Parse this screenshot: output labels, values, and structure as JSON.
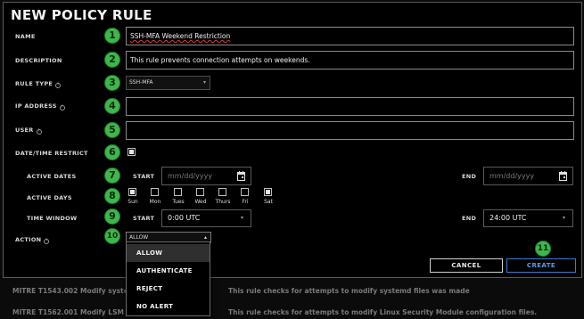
{
  "background_rows": [
    {
      "name": "MITRE T1543.002 Modify systemd",
      "desc": "This rule checks for attempts to modify systemd files was made"
    },
    {
      "name": "MITRE T1562.001 Modify LSM configuration files",
      "desc": "This rule checks for attempts to modify Linux Security Module configuration files."
    }
  ],
  "modal": {
    "title": "NEW POLICY RULE",
    "name": {
      "label": "NAME",
      "value": "SSH-MFA Weekend Restriction"
    },
    "description": {
      "label": "DESCRIPTION",
      "value": "This rule prevents connection attempts on weekends."
    },
    "rule_type": {
      "label": "RULE TYPE",
      "value": "SSH-MFA"
    },
    "ip_address": {
      "label": "IP ADDRESS",
      "value": ""
    },
    "user": {
      "label": "USER",
      "value": ""
    },
    "datetime_restrict": {
      "label": "DATE/TIME RESTRICT",
      "checked": true
    },
    "active_dates": {
      "label": "ACTIVE DATES",
      "start_label": "START",
      "end_label": "END",
      "start_placeholder": "mm/dd/yyyy",
      "end_placeholder": "mm/dd/yyyy"
    },
    "active_days": {
      "label": "ACTIVE DAYS",
      "days": [
        {
          "label": "Sun",
          "checked": true
        },
        {
          "label": "Mon",
          "checked": false
        },
        {
          "label": "Tues",
          "checked": false
        },
        {
          "label": "Wed",
          "checked": false
        },
        {
          "label": "Thurs",
          "checked": false
        },
        {
          "label": "Fri",
          "checked": false
        },
        {
          "label": "Sat",
          "checked": true
        }
      ]
    },
    "time_window": {
      "label": "TIME WINDOW",
      "start_label": "START",
      "end_label": "END",
      "start_value": "0:00 UTC",
      "end_value": "24:00 UTC"
    },
    "action": {
      "label": "ACTION",
      "value": "ALLOW",
      "options": [
        "ALLOW",
        "AUTHENTICATE",
        "REJECT",
        "NO ALERT"
      ],
      "highlighted": "ALLOW"
    },
    "cancel_label": "CANCEL",
    "create_label": "CREATE"
  },
  "badges": [
    "1",
    "2",
    "3",
    "4",
    "5",
    "6",
    "7",
    "8",
    "9",
    "10",
    "11"
  ],
  "colors": {
    "badge": "#3fb64d",
    "create": "#5a9ae8",
    "spellcheck": "#d63a3a"
  }
}
